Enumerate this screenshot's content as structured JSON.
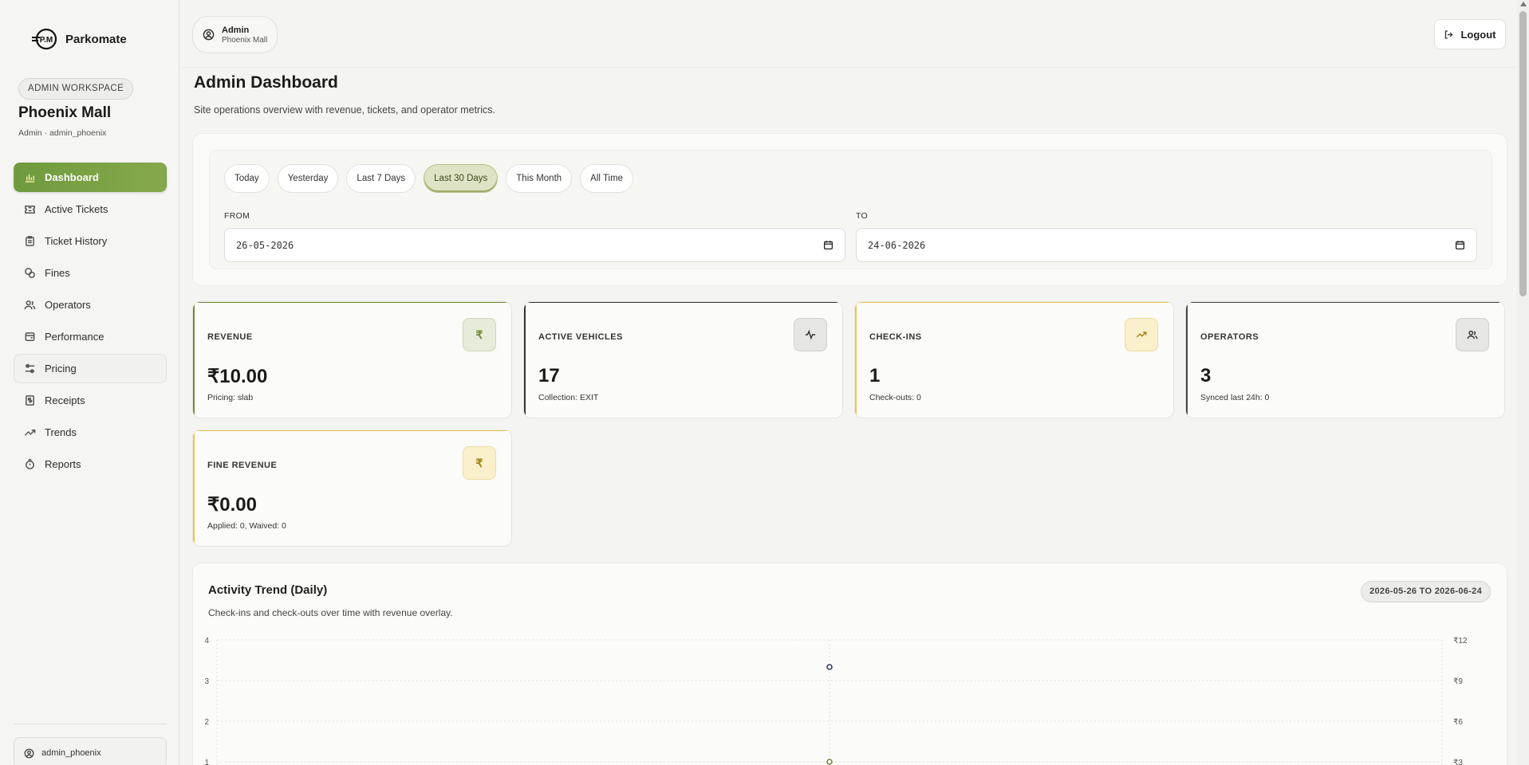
{
  "brand": {
    "name": "Parkomate",
    "logo_mark": "P.M"
  },
  "sidebar": {
    "workspace_badge": "ADMIN WORKSPACE",
    "site_name": "Phoenix Mall",
    "site_sub": "Admin · admin_phoenix",
    "items": [
      {
        "label": "Dashboard",
        "icon": "bar-chart-icon"
      },
      {
        "label": "Active Tickets",
        "icon": "ticket-icon"
      },
      {
        "label": "Ticket History",
        "icon": "clipboard-icon"
      },
      {
        "label": "Fines",
        "icon": "coins-icon"
      },
      {
        "label": "Operators",
        "icon": "users-icon"
      },
      {
        "label": "Performance",
        "icon": "gauge-icon"
      },
      {
        "label": "Pricing",
        "icon": "sliders-icon"
      },
      {
        "label": "Receipts",
        "icon": "receipt-icon"
      },
      {
        "label": "Trends",
        "icon": "trend-icon"
      },
      {
        "label": "Reports",
        "icon": "report-icon"
      }
    ],
    "user": "admin_phoenix"
  },
  "header": {
    "user_role": "Admin",
    "user_site": "Phoenix Mall",
    "logout_label": "Logout",
    "title": "Admin Dashboard",
    "subtitle": "Site operations overview with revenue, tickets, and operator metrics."
  },
  "filters": {
    "ranges": [
      "Today",
      "Yesterday",
      "Last 7 Days",
      "Last 30 Days",
      "This Month",
      "All Time"
    ],
    "active_range": "Last 30 Days",
    "from_label": "FROM",
    "from_value": "26-05-2026",
    "to_label": "TO",
    "to_value": "24-06-2026"
  },
  "kpis": [
    {
      "label": "REVENUE",
      "value": "₹10.00",
      "note": "Pricing: slab",
      "icon": "rupee-icon",
      "glyph": "₹",
      "accent": "#6f8a3a"
    },
    {
      "label": "ACTIVE VEHICLES",
      "value": "17",
      "note": "Collection: EXIT",
      "icon": "activity-icon",
      "accent": "#333333"
    },
    {
      "label": "CHECK-INS",
      "value": "1",
      "note": "Check-outs: 0",
      "icon": "trend-up-icon",
      "accent": "#e6c44c"
    },
    {
      "label": "OPERATORS",
      "value": "3",
      "note": "Synced last 24h: 0",
      "icon": "users-icon",
      "accent": "#444444"
    },
    {
      "label": "FINE REVENUE",
      "value": "₹0.00",
      "note": "Applied: 0, Waived: 0",
      "icon": "rupee-icon",
      "glyph": "₹",
      "accent": "#e6c44c"
    }
  ],
  "chart": {
    "title": "Activity Trend (Daily)",
    "subtitle": "Check-ins and check-outs over time with revenue overlay.",
    "range_pill": "2026-05-26 TO 2026-06-24"
  },
  "chart_data": {
    "type": "line",
    "title": "Activity Trend (Daily)",
    "y_left_ticks": [
      "4",
      "3",
      "2",
      "1"
    ],
    "y_right_ticks": [
      "₹12",
      "₹9",
      "₹6",
      "₹3"
    ],
    "ylim_left": [
      0,
      4
    ],
    "ylim_right": [
      0,
      12
    ],
    "grid": true,
    "series": [
      {
        "axis": "right",
        "color": "#2c3e6b",
        "points": [
          {
            "x_index": 0.5,
            "y": 10
          }
        ]
      },
      {
        "axis": "left",
        "color": "#6f8a3a",
        "points": [
          {
            "x_index": 0.5,
            "y": 1
          }
        ]
      }
    ]
  }
}
